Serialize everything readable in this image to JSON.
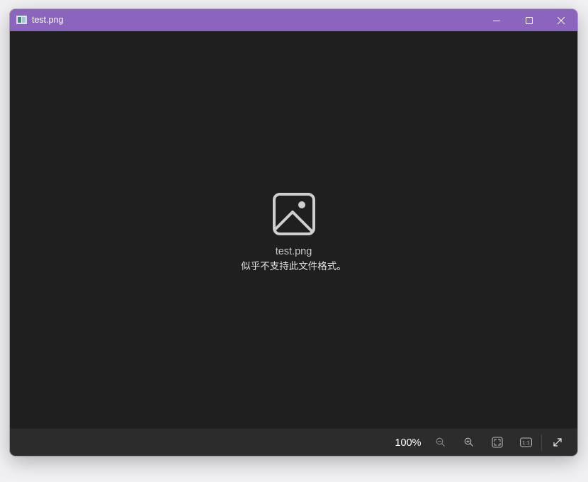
{
  "window": {
    "title": "test.png",
    "controls": {
      "minimize": "minimize",
      "maximize": "maximize",
      "close": "close"
    },
    "accent_color": "#8b64bd"
  },
  "viewer": {
    "background_color": "#1f1f1f",
    "icon": "image-icon",
    "filename": "test.png",
    "message": "似乎不支持此文件格式。"
  },
  "toolbar": {
    "zoom_label": "100%",
    "buttons": [
      {
        "name": "zoom-out",
        "icon": "zoom-out-icon"
      },
      {
        "name": "zoom-in",
        "icon": "zoom-in-icon"
      },
      {
        "name": "fit-to-window",
        "icon": "fit-screen-icon"
      },
      {
        "name": "actual-size",
        "icon": "actual-size-icon",
        "text": "1:1"
      },
      {
        "name": "fullscreen",
        "icon": "expand-icon"
      }
    ]
  }
}
